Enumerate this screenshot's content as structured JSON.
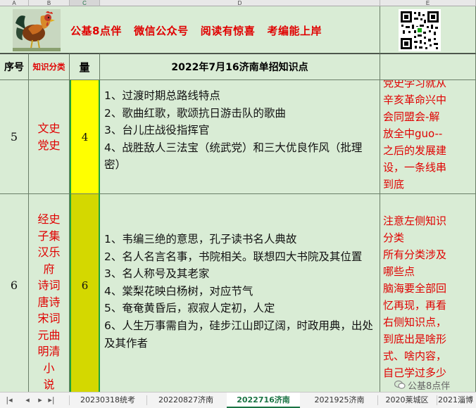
{
  "columns": [
    "A",
    "B",
    "C",
    "D",
    "E"
  ],
  "banner": {
    "text": "公基8点伴   微信公众号   阅读有惊喜   考编能上岸"
  },
  "header": {
    "seq": "序号",
    "category": "知识分类",
    "amount": "量",
    "title": "2022年7月16济南单招知识点"
  },
  "rows": [
    {
      "seq": "5",
      "category_lines": [
        "文史",
        "党史"
      ],
      "amount": "4",
      "items": [
        "1、过渡时期总路线特点",
        "2、歌曲红歌，歌颂抗日游击队的歌曲",
        "3、台儿庄战役指挥官",
        "4、战胜敌人三法宝（统武党）和三大优良作风（批理密）"
      ],
      "note_lines": [
        "党史学习就从",
        "辛亥革命兴中",
        "会同盟会-解",
        "放全中guo--",
        "之后的发展建",
        "设，一条线串",
        "到底"
      ]
    },
    {
      "seq": "6",
      "category_lines": [
        "经史",
        "子集",
        "汉乐",
        "府",
        "诗词",
        "唐诗",
        "宋词",
        "元曲",
        "明清",
        "小",
        "说"
      ],
      "amount": "6",
      "items": [
        "1、韦编三绝的意思，孔子读书名人典故",
        "2、名人名言名事，书院相关。联想四大书院及其位置",
        "3、名人称号及其老家",
        "4、棠梨花映白杨树，对应节气",
        "5、奄奄黄昏后，寂寂人定初，人定",
        "6、人生万事需自为，硅步江山即辽阔，时政用典，出处及其作者"
      ],
      "note_lines": [
        "注意左侧知识",
        "分类",
        "所有分类涉及",
        "哪些点",
        "脑海要全部回",
        "忆再现，再看",
        "右侧知识点，",
        "到底出是啥形",
        "式、啥内容，",
        "自己学过多少"
      ]
    }
  ],
  "tabs": [
    "20230318统考",
    "20220827济南",
    "2022716济南",
    "2021925济南",
    "2020莱城区",
    "2021淄博"
  ],
  "active_tab": "2022716济南",
  "watermark": "公基8点伴",
  "colors": {
    "sheet_bg": "#d9ecd5",
    "amount_row5": "#ffff00",
    "amount_row6": "#d4d800",
    "accent_red": "#e00000",
    "active_tab": "#1a7343"
  }
}
